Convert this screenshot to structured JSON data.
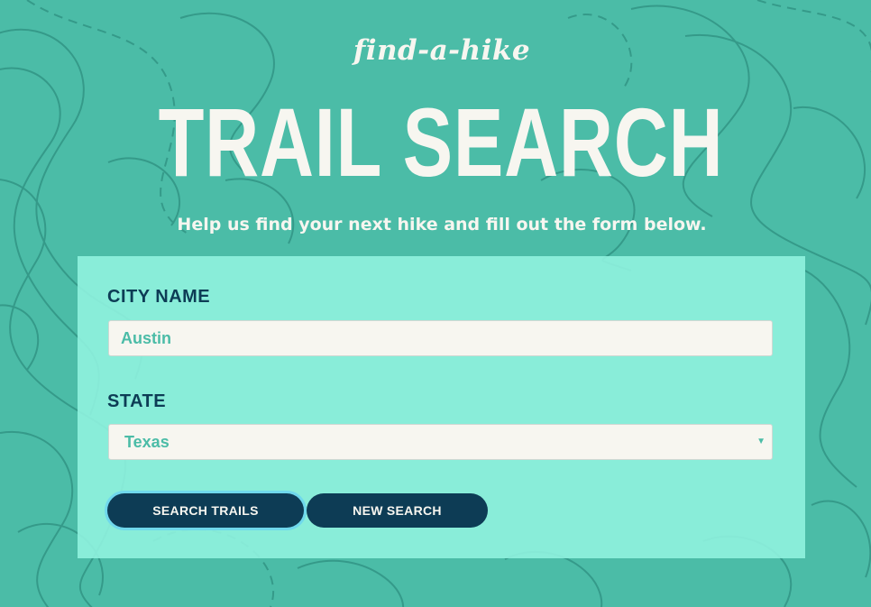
{
  "header": {
    "tagline": "find-a-hike",
    "title": "TRAIL SEARCH",
    "subtitle": "Help us find your next hike and fill out the form below."
  },
  "form": {
    "city": {
      "label": "CITY NAME",
      "value": "Austin"
    },
    "state": {
      "label": "STATE",
      "selected": "Texas"
    },
    "buttons": {
      "search_label": "SEARCH TRAILS",
      "new_label": "NEW SEARCH"
    }
  },
  "colors": {
    "background": "#4bbca7",
    "panel": "#92f4e0",
    "accent_dark": "#0d3c55",
    "text_light": "#f7f6f0",
    "focus_ring": "#6fd8ec"
  },
  "icons": {
    "select_arrow": "chevron-down-icon",
    "background": "topographic-map-pattern"
  }
}
